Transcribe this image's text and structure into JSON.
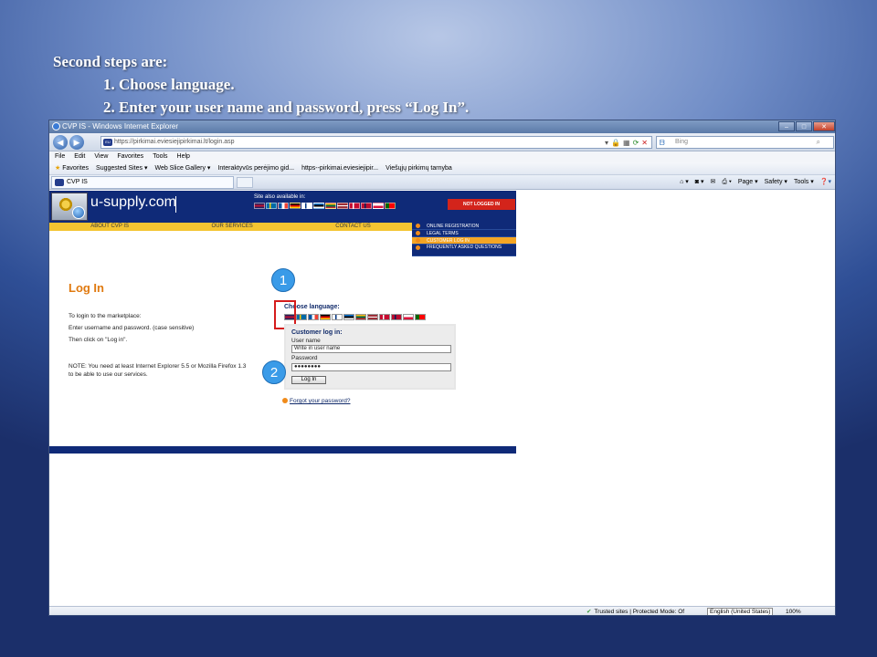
{
  "slide": {
    "heading": "Second steps are:",
    "step1": "1. Choose language.",
    "step2": "2. Enter your user name and password, press “Log In”."
  },
  "browser": {
    "window_title": "CVP IS - Windows Internet Explorer",
    "url": "https://pirkimai.eviesiejipirkimai.lt/login.asp",
    "search_placeholder": "Bing",
    "menu": [
      "File",
      "Edit",
      "View",
      "Favorites",
      "Tools",
      "Help"
    ],
    "favorites_label": "Favorites",
    "favorites": [
      "Suggested Sites ▾",
      "Web Slice Gallery ▾",
      "Interaktyvūs perėjimo gid...",
      "https--pirkimai.eviesiejipir...",
      "Viešųjų pirkimų tarnyba"
    ],
    "tab_title": "CVP IS",
    "commands": [
      "Page ▾",
      "Safety ▾",
      "Tools ▾"
    ],
    "status_trusted": "Trusted sites | Protected Mode: Of",
    "status_language": "English (United States)",
    "zoom": "100%"
  },
  "site": {
    "logo": "u-supply.com",
    "available_in": "Site also available in:",
    "not_logged_in": "NOT LOGGED IN",
    "top_menu": [
      "ABOUT CVP IS",
      "OUR SERVICES",
      "CONTACT US"
    ],
    "side_menu": [
      "ONLINE REGISTRATION",
      "LEGAL TERMS",
      "CUSTOMER LOG IN",
      "FREQUENTLY ASKED QUESTIONS"
    ],
    "login_title": "Log In",
    "info_lines": [
      "To login to the marketplace:",
      "Enter username and password. (case sensitive)",
      "Then click on \"Log in\"."
    ],
    "note": "NOTE: You need at least Internet Explorer 5.5 or Mozilla Firefox 1.3 to be able to use our services.",
    "choose_language": "Choose language:",
    "customer_login": "Customer log in:",
    "username_label": "User name",
    "username_value": "Write in user name",
    "password_label": "Password",
    "password_value": "●●●●●●●●",
    "login_button": "Log In",
    "forgot": "Forgot your password?"
  },
  "markers": {
    "m1": "1",
    "m2": "2"
  },
  "colors": {
    "site_navy": "#0f2a78",
    "site_yellow": "#f4c431",
    "accent_orange": "#e07a10",
    "highlight_red": "#d51c1c",
    "marker_blue": "#3a9be8"
  }
}
